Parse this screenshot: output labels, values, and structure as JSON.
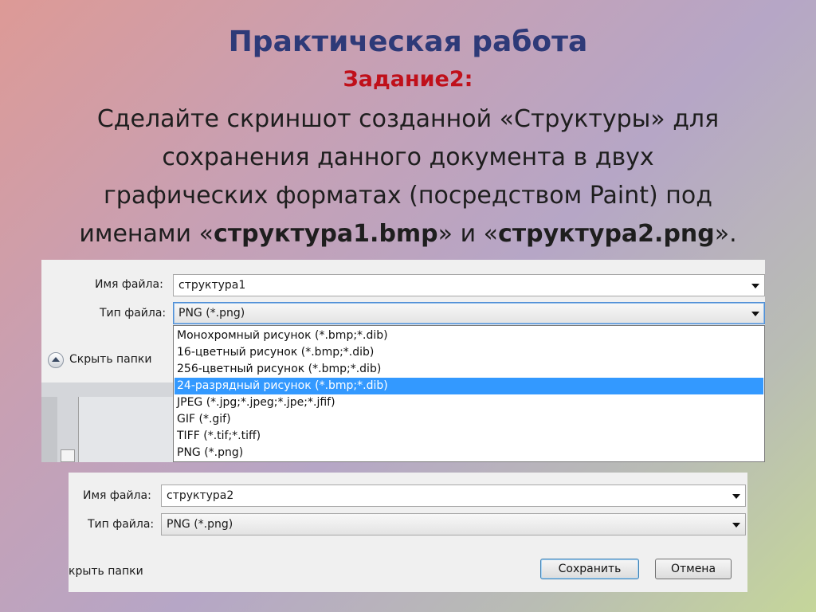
{
  "slide": {
    "title": "Практическая работа",
    "task_label": "Задание2:",
    "task_line1": "Сделайте скриншот созданной «Структуры» для",
    "task_line2": "сохранения данного документа в двух",
    "task_line3": "графических форматах (посредством Paint) под",
    "task_line4_prefix": "именами «",
    "task_line4_name1": "структура1.bmp",
    "task_line4_mid": "» и «",
    "task_line4_name2": "структура2.png",
    "task_line4_suffix": "»."
  },
  "dialog1": {
    "filename_label": "Имя файла:",
    "filename_value": "структура1",
    "filetype_label": "Тип файла:",
    "filetype_value": "PNG (*.png)",
    "hide_folders": "Скрыть папки",
    "options": [
      "Монохромный рисунок (*.bmp;*.dib)",
      "16-цветный рисунок (*.bmp;*.dib)",
      "256-цветный рисунок (*.bmp;*.dib)",
      "24-разрядный рисунок (*.bmp;*.dib)",
      "JPEG (*.jpg;*.jpeg;*.jpe;*.jfif)",
      "GIF (*.gif)",
      "TIFF (*.tif;*.tiff)",
      "PNG (*.png)"
    ],
    "highlighted_option": "24-разрядный рисунок (*.bmp;*.dib)"
  },
  "dialog2": {
    "filename_label": "Имя файла:",
    "filename_value": "структура2",
    "filetype_label": "Тип файла:",
    "filetype_value": "PNG (*.png)",
    "hide_folders": "крыть папки",
    "save_button": "Сохранить",
    "cancel_button": "Отмена"
  },
  "colors": {
    "title": "#2e3a78",
    "task_label": "#c0101a",
    "highlight": "#3399ff"
  }
}
